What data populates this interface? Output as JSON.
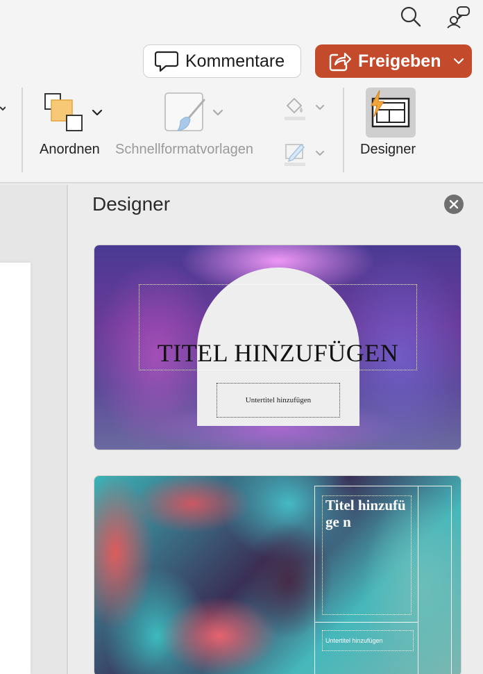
{
  "toolbar": {
    "comments_label": "Kommentare",
    "share_label": "Freigeben"
  },
  "ribbon": {
    "arrange_label": "Anordnen",
    "quickstyles_label": "Schnellformatvorlagen",
    "designer_label": "Designer"
  },
  "designer": {
    "title": "Designer",
    "designs": [
      {
        "title": "Titel hinzufügen",
        "subtitle": "Untertitel hinzufügen"
      },
      {
        "title": "Titel hinzufüge n",
        "subtitle": "Untertitel hinzufügen"
      }
    ]
  },
  "colors": {
    "share_button": "#c34a2b",
    "designer_active_bg": "#cfcfcf",
    "designer_icon_accent": "#f2a53a"
  }
}
